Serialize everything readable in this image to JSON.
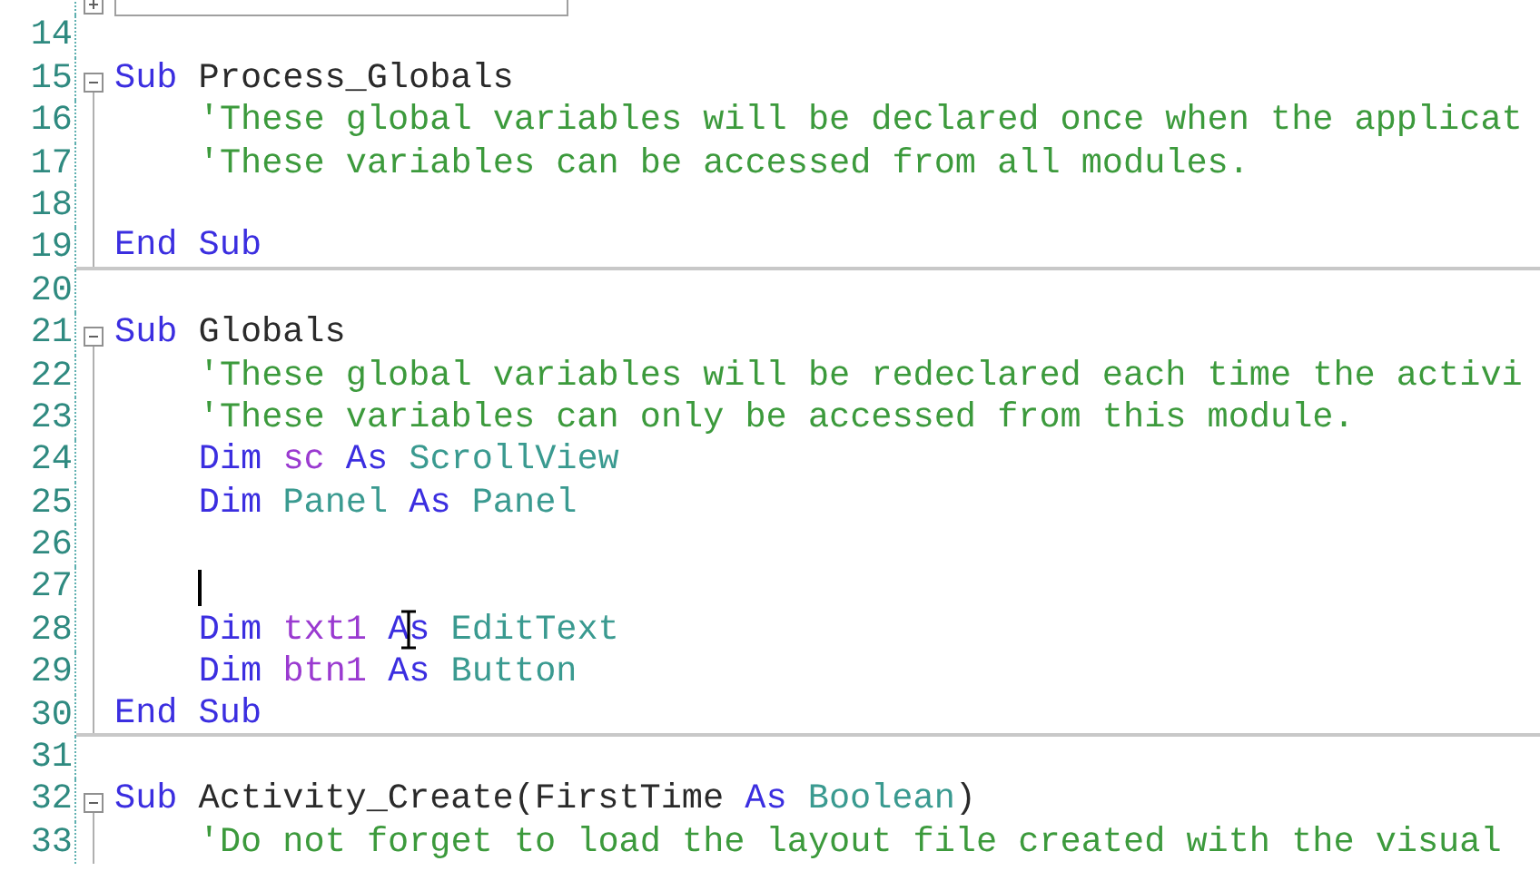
{
  "editor": {
    "lines": [
      {
        "kind": "collapsed-region",
        "indented": false
      },
      {
        "number": "14",
        "kind": "blank"
      },
      {
        "number": "15",
        "kind": "block-start",
        "indented": false,
        "tokens": [
          {
            "kind": "keyword",
            "text": "Sub"
          },
          {
            "kind": "plain",
            "text": "Process_Globals"
          }
        ]
      },
      {
        "number": "16",
        "kind": "block-body",
        "indented": true,
        "tokens": [
          {
            "kind": "comment",
            "text": "'These global variables will be declared once when the applicat"
          }
        ]
      },
      {
        "number": "17",
        "kind": "block-body",
        "indented": true,
        "tokens": [
          {
            "kind": "comment",
            "text": "'These variables can be accessed from all modules."
          }
        ]
      },
      {
        "number": "18",
        "kind": "block-body"
      },
      {
        "number": "19",
        "kind": "block-end",
        "indented": false,
        "tokens": [
          {
            "kind": "keyword",
            "text": "End"
          },
          {
            "kind": "keyword",
            "text": "Sub"
          }
        ]
      },
      {
        "number": "20",
        "kind": "blank"
      },
      {
        "number": "21",
        "kind": "block-start",
        "indented": false,
        "tokens": [
          {
            "kind": "keyword",
            "text": "Sub"
          },
          {
            "kind": "plain",
            "text": "Globals"
          }
        ]
      },
      {
        "number": "22",
        "kind": "block-body",
        "indented": true,
        "tokens": [
          {
            "kind": "comment",
            "text": "'These global variables will be redeclared each time the activi"
          }
        ]
      },
      {
        "number": "23",
        "kind": "block-body",
        "indented": true,
        "tokens": [
          {
            "kind": "comment",
            "text": "'These variables can only be accessed from this module."
          }
        ]
      },
      {
        "number": "24",
        "kind": "block-body",
        "indented": true,
        "tokens": [
          {
            "kind": "keyword",
            "text": "Dim"
          },
          {
            "kind": "variable",
            "text": "sc"
          },
          {
            "kind": "keyword",
            "text": "As"
          },
          {
            "kind": "type",
            "text": "ScrollView"
          }
        ]
      },
      {
        "number": "25",
        "kind": "block-body",
        "indented": true,
        "tokens": [
          {
            "kind": "keyword",
            "text": "Dim"
          },
          {
            "kind": "type",
            "text": "Panel"
          },
          {
            "kind": "keyword",
            "text": "As"
          },
          {
            "kind": "type",
            "text": "Panel"
          }
        ]
      },
      {
        "number": "26",
        "kind": "block-body"
      },
      {
        "number": "27",
        "kind": "block-body",
        "indented": true,
        "caret": true
      },
      {
        "number": "28",
        "kind": "block-body",
        "indented": true,
        "tokens": [
          {
            "kind": "keyword",
            "text": "Dim"
          },
          {
            "kind": "variable",
            "text": "txt1"
          },
          {
            "kind": "keyword",
            "text": "As",
            "pointer": true
          },
          {
            "kind": "type",
            "text": "EditText"
          }
        ]
      },
      {
        "number": "29",
        "kind": "block-body",
        "indented": true,
        "tokens": [
          {
            "kind": "keyword",
            "text": "Dim"
          },
          {
            "kind": "variable",
            "text": "btn1"
          },
          {
            "kind": "keyword",
            "text": "As"
          },
          {
            "kind": "type",
            "text": "Button"
          }
        ]
      },
      {
        "number": "30",
        "kind": "block-end",
        "indented": false,
        "tokens": [
          {
            "kind": "keyword",
            "text": "End"
          },
          {
            "kind": "keyword",
            "text": "Sub"
          }
        ]
      },
      {
        "number": "31",
        "kind": "blank"
      },
      {
        "number": "32",
        "kind": "block-start",
        "indented": false,
        "tokens": [
          {
            "kind": "keyword",
            "text": "Sub"
          },
          {
            "kind": "plain",
            "text": "Activity_Create(FirstTime"
          },
          {
            "kind": "keyword",
            "text": "As"
          },
          {
            "kind": "type",
            "text": "Boolean"
          },
          {
            "kind": "plain",
            "text": ")",
            "joined": true
          }
        ]
      },
      {
        "number": "33",
        "kind": "block-body",
        "indented": true,
        "tokens": [
          {
            "kind": "comment",
            "text": "'Do not forget to load the layout file created with the visual"
          }
        ]
      }
    ]
  }
}
